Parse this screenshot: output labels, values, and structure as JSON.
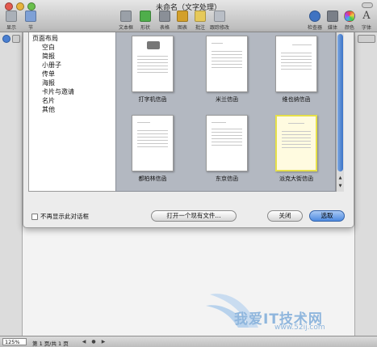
{
  "window": {
    "title": "未命名（文字处理）"
  },
  "toolbar": {
    "left": [
      {
        "label": "显示",
        "icon": "view-icon"
      },
      {
        "label": "节",
        "icon": "section-icon"
      }
    ],
    "center": [
      {
        "label": "文本框",
        "icon": "textbox-icon",
        "color": "#9aa0a8"
      },
      {
        "label": "形状",
        "icon": "shapes-icon",
        "color": "#4fae4b"
      },
      {
        "label": "表格",
        "icon": "table-icon",
        "color": "#8a8f97"
      },
      {
        "label": "图表",
        "icon": "chart-icon",
        "color": "#d3a02a"
      },
      {
        "label": "批注",
        "icon": "comment-icon",
        "color": "#e6c95a"
      },
      {
        "label": "跟踪修改",
        "icon": "track-changes-icon",
        "color": "#b9bec6"
      }
    ],
    "right": [
      {
        "label": "检查器",
        "icon": "inspector-icon",
        "color": "#3f73c2"
      },
      {
        "label": "媒体",
        "icon": "media-icon",
        "color": "#7a7f88"
      },
      {
        "label": "颜色",
        "icon": "colors-icon",
        "color": "#c64b8f"
      },
      {
        "label": "字体",
        "icon": "fonts-icon",
        "color": "#444444"
      }
    ]
  },
  "template_chooser": {
    "categories_heading": "页面布局",
    "categories": [
      "空白",
      "简报",
      "小册子",
      "传单",
      "海报",
      "卡片与邀请",
      "名片",
      "其他"
    ],
    "templates": [
      {
        "label": "打字机信函",
        "selected": false
      },
      {
        "label": "米兰信函",
        "selected": false
      },
      {
        "label": "维也纳信函",
        "selected": false
      },
      {
        "label": "都柏林信函",
        "selected": false
      },
      {
        "label": "东京信函",
        "selected": false
      },
      {
        "label": "派克大街信函",
        "selected": true
      }
    ],
    "dont_show_label": "不再显示此对话框",
    "open_existing_label": "打开一个现有文件...",
    "close_label": "关闭",
    "choose_label": "选取"
  },
  "statusbar": {
    "zoom": "125%",
    "page_info": "第 1 页/共 1 页"
  },
  "watermark": {
    "text": "我爱IT技术网",
    "sub": "www.52ij.com"
  }
}
